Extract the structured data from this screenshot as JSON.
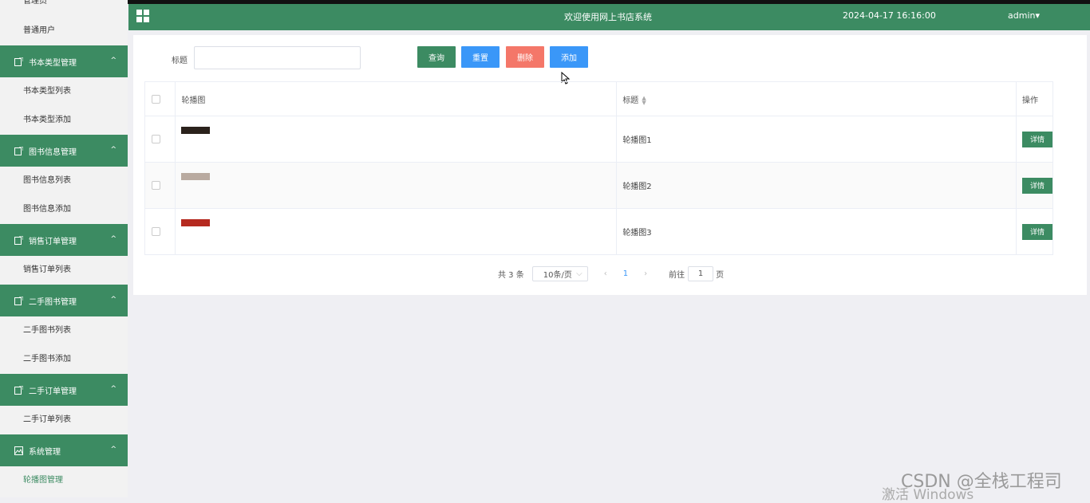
{
  "header": {
    "title": "欢迎使用网上书店系统",
    "datetime": "2024-04-17 16:16:00",
    "user": "admin"
  },
  "sidebar": {
    "top_item": "管理员",
    "users_item": "普通用户",
    "groups": [
      {
        "label": "书本类型管理",
        "items": [
          "书本类型列表",
          "书本类型添加"
        ]
      },
      {
        "label": "图书信息管理",
        "items": [
          "图书信息列表",
          "图书信息添加"
        ]
      },
      {
        "label": "销售订单管理",
        "items": [
          "销售订单列表"
        ]
      },
      {
        "label": "二手图书管理",
        "items": [
          "二手图书列表",
          "二手图书添加"
        ]
      },
      {
        "label": "二手订单管理",
        "items": [
          "二手订单列表"
        ]
      },
      {
        "label": "系统管理",
        "items": [
          "轮播图管理"
        ]
      }
    ]
  },
  "search": {
    "label": "标题",
    "value": ""
  },
  "buttons": {
    "query": "查询",
    "reset": "重置",
    "delete": "删除",
    "add": "添加"
  },
  "table": {
    "headers": {
      "image": "轮播图",
      "title": "标题",
      "op": "操作"
    },
    "rows": [
      {
        "title": "轮播图1",
        "action": "详情",
        "thumb_color": "#2b221c"
      },
      {
        "title": "轮播图2",
        "action": "详情",
        "thumb_color": "#b9aaa0"
      },
      {
        "title": "轮播图3",
        "action": "详情",
        "thumb_color": "#b52a20"
      }
    ]
  },
  "pager": {
    "total": "共 3 条",
    "page_size": "10条/页",
    "current": "1",
    "goto_label": "前往",
    "goto_value": "1",
    "page_suffix": "页"
  },
  "watermark": {
    "csdn": "CSDN @全栈工程司",
    "windows": "激活 Windows"
  },
  "colors": {
    "primary": "#3c8b62",
    "blue": "#3a97f8",
    "danger": "#f47769"
  }
}
